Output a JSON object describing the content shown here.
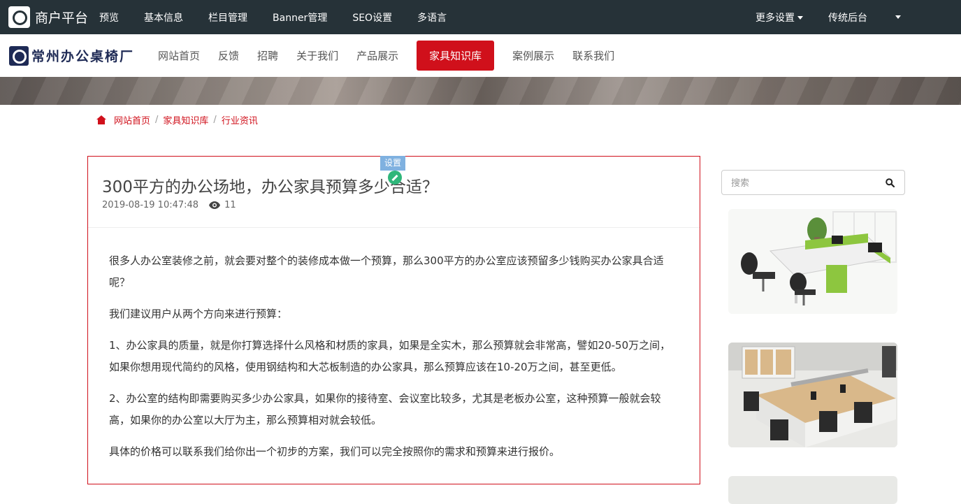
{
  "admin_bar": {
    "brand": "商户平台",
    "nav": [
      "预览",
      "基本信息",
      "栏目管理",
      "Banner管理",
      "SEO设置",
      "多语言"
    ],
    "more_settings": "更多设置",
    "legacy_backend": "传统后台"
  },
  "site": {
    "brand_name": "常州办公桌椅厂",
    "nav": [
      "网站首页",
      "反馈",
      "招聘",
      "关于我们",
      "产品展示",
      "家具知识库",
      "案例展示",
      "联系我们"
    ],
    "active_nav": "家具知识库"
  },
  "breadcrumb": [
    "网站首页",
    "家具知识库",
    "行业资讯"
  ],
  "article": {
    "settings_badge": "设置",
    "title": "300平方的办公场地，办公家具预算多少合适？",
    "date": "2019-08-19 10:47:48",
    "views": "11",
    "paragraphs": [
      "很多人办公室装修之前，就会要对整个的装修成本做一个预算，那么300平方的办公室应该预留多少钱购买办公家具合适呢？",
      "我们建议用户从两个方向来进行预算：",
      "1、办公家具的质量，就是你打算选择什么风格和材质的家具，如果是全实木，那么预算就会非常高，譬如20-50万之间，如果你想用现代简约的风格，使用钢结构和大芯板制造的办公家具，那么预算应该在10-20万之间，甚至更低。",
      "2、办公室的结构即需要购买多少办公家具，如果你的接待室、会议室比较多，尤其是老板办公室，这种预算一般就会较高，如果你的办公室以大厅为主，那么预算相对就会较低。",
      "具体的价格可以联系我们给你出一个初步的方案，我们可以完全按照你的需求和预算来进行报价。"
    ]
  },
  "sidebar": {
    "search_placeholder": "搜索"
  },
  "colors": {
    "admin_bg": "#263238",
    "accent_red": "#d0101b",
    "brand_navy": "#1e2a55",
    "badge_blue": "#7fb1e0",
    "edit_green": "#2fb67a"
  }
}
